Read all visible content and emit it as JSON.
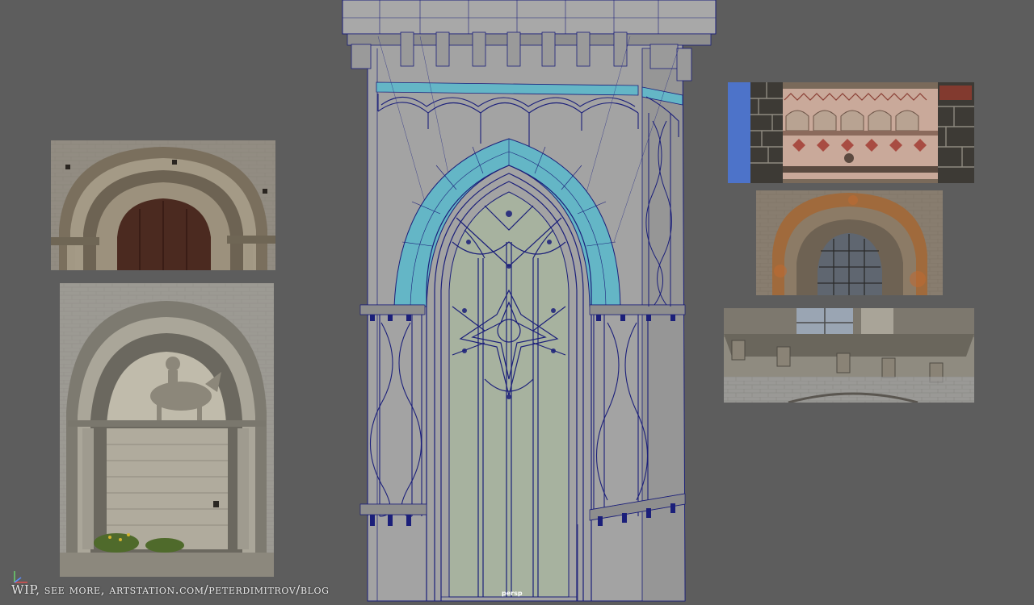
{
  "viewport": {
    "camera_label": "persp",
    "caption": "WIP, see more, artstation.com/peterdimitrov/blog"
  },
  "references": [
    {
      "name": "romanesque-door-arch-photo"
    },
    {
      "name": "carved-tympanum-horseman-photo"
    },
    {
      "name": "polychrome-tower-arcade-photo"
    },
    {
      "name": "arched-window-photo"
    },
    {
      "name": "corbel-cornice-photo"
    }
  ],
  "colors": {
    "viewport_bg": "#5d5d5d",
    "mesh_fill": "#9e9e9e",
    "wire": "#1b1f7a",
    "selected": "#64b6c6",
    "glass": "#a7b29f"
  }
}
